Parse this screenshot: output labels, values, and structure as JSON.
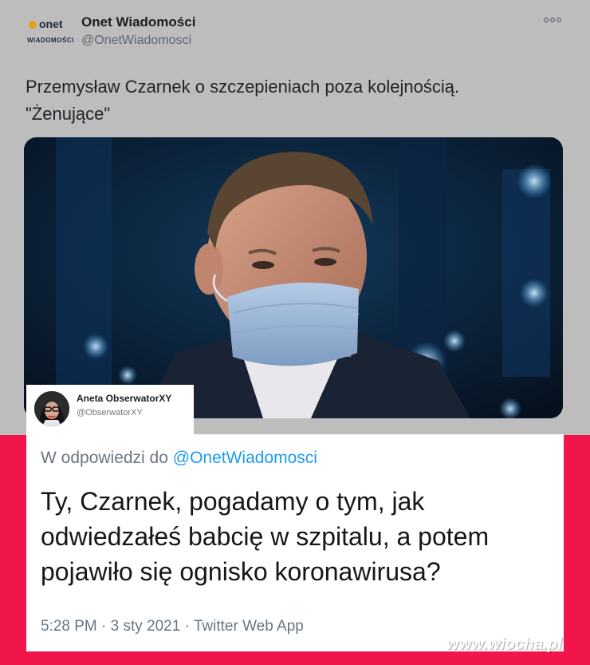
{
  "top_tweet": {
    "logo_brand": "onet",
    "logo_sub": "WIADOMOŚCI",
    "author_name": "Onet Wiadomości",
    "author_handle": "@OnetWiadomosci",
    "more_icon": "more-horizontal-icon",
    "text_line1": "Przemysław Czarnek o szczepieniach poza kolejnością.",
    "text_line2": "\"Żenujące\""
  },
  "reply": {
    "author_name": "Aneta ObserwatorXY",
    "author_handle": "@ObserwatorXY",
    "reply_to_prefix": "W odpowiedzi do",
    "reply_to_mention": "@OnetWiadomosci",
    "text_line1": "Ty, Czarnek, pogadamy o tym, jak",
    "text_line2": "odwiedzałeś babcię w szpitalu, a potem",
    "text_line3": "pojawiło się ognisko koronawirusa?",
    "meta": "5:28 PM · 3 sty 2021 · Twitter Web App"
  },
  "watermark": "www.wiocha.pl",
  "colors": {
    "accent_red": "#f0164b",
    "mention_blue": "#1d9bf0",
    "onet_dot": "#e0a21a"
  }
}
